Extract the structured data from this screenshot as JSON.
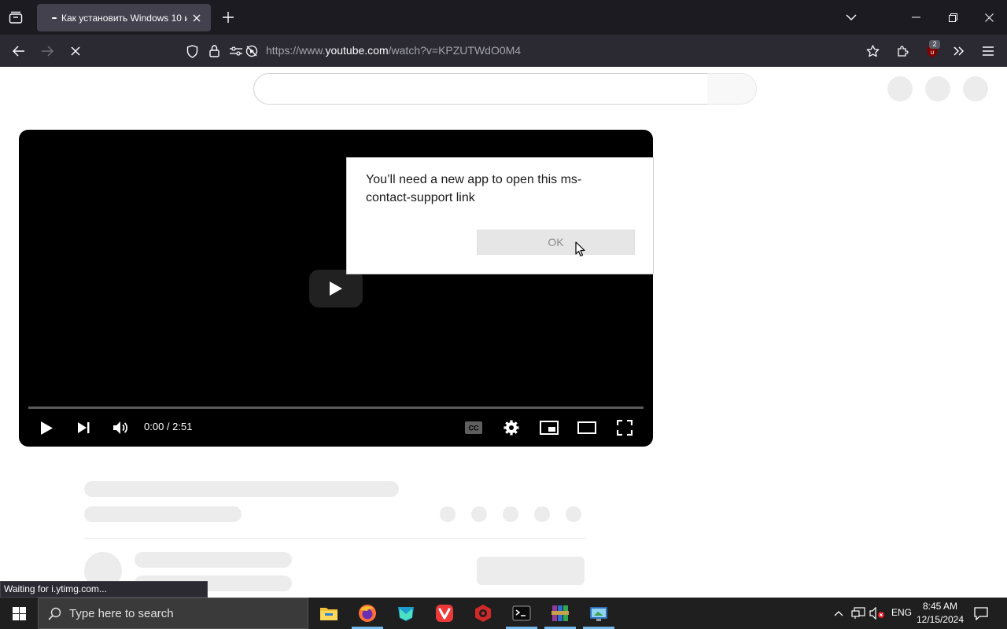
{
  "browser": {
    "tab": {
      "title": "Как установить Windows 10 и"
    },
    "url": {
      "prefix": "https://www.",
      "domain": "youtube.com",
      "path": "/watch?v=KPZUTWdO0M4"
    },
    "extension_badge": "2",
    "status_text": "Waiting for i.ytimg.com..."
  },
  "player": {
    "time": "0:00 / 2:51",
    "progress": 0
  },
  "dialog": {
    "message": "You’ll need a new app to open this ms-contact-support link",
    "ok_label": "OK"
  },
  "taskbar": {
    "search_placeholder": "Type here to search",
    "language": "ENG",
    "time": "8:45 AM",
    "date": "12/15/2024"
  },
  "colors": {
    "accent": "#76b9ed",
    "tabbar_bg": "#1c1b22",
    "toolbar_bg": "#2b2a33",
    "player_bg": "#000000",
    "skeleton": "#ececec"
  }
}
